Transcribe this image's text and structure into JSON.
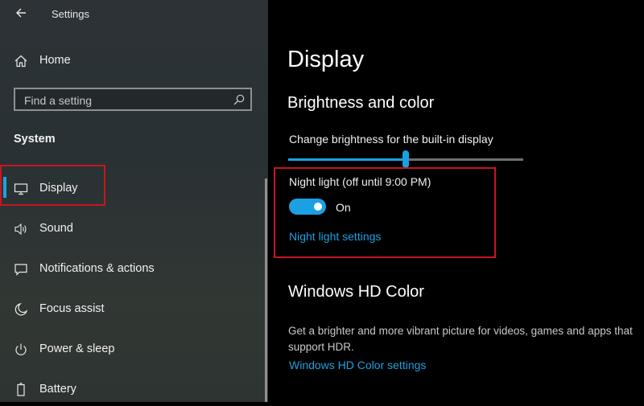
{
  "window": {
    "title": "Settings"
  },
  "sidebar": {
    "home_label": "Home",
    "search_placeholder": "Find a setting",
    "section_label": "System",
    "items": [
      {
        "label": "Display",
        "icon": "monitor-icon",
        "selected": true
      },
      {
        "label": "Sound",
        "icon": "speaker-icon"
      },
      {
        "label": "Notifications & actions",
        "icon": "message-icon"
      },
      {
        "label": "Focus assist",
        "icon": "moon-icon"
      },
      {
        "label": "Power & sleep",
        "icon": "power-icon"
      },
      {
        "label": "Battery",
        "icon": "battery-icon"
      }
    ]
  },
  "main": {
    "title": "Display",
    "brightness_heading": "Brightness and color",
    "brightness_label": "Change brightness for the built-in display",
    "brightness_level": 0.5,
    "night_light_label": "Night light (off until 9:00 PM)",
    "night_light_state": "On",
    "night_light_link": "Night light settings",
    "hdr_heading": "Windows HD Color",
    "hdr_description": "Get a brighter and more vibrant picture for videos, games and apps that support HDR.",
    "hdr_link": "Windows HD Color settings"
  },
  "colors": {
    "accent": "#1ba1e2",
    "highlight_box": "#c8161d",
    "sidebar_bg": "#2c3236",
    "main_bg": "#000000"
  }
}
